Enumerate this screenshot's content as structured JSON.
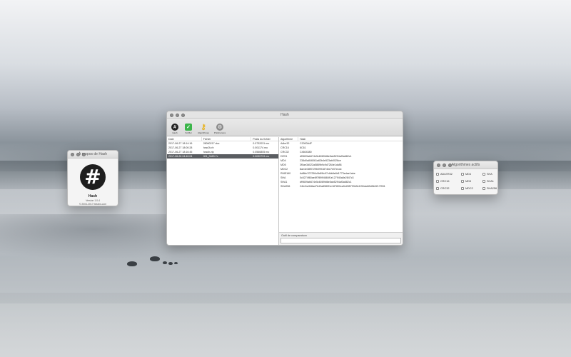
{
  "main_window": {
    "title": "Hash",
    "toolbar": [
      {
        "label": "Hash",
        "icon": "hash-icon"
      },
      {
        "label": "Vérifier",
        "icon": "shield-check-icon"
      },
      {
        "label": "Algorithmes",
        "icon": "key-icon"
      },
      {
        "label": "Préférences",
        "icon": "gear-icon"
      }
    ],
    "files_table": {
      "headers": [
        "Date",
        "Fichier",
        "Poids du fichier"
      ],
      "rows": [
        [
          "2017-06-27 18:14:16",
          "28060217.doc",
          "0.0732031 mo"
        ],
        [
          "2017-06-27 18:00:28",
          "hxsr2k.rb",
          "0.001174 mo"
        ],
        [
          "2017-06-27 18:16:45",
          "hxsdir.zip",
          "0.0566805 mo"
        ],
        [
          "2017-06-26 04:40:04",
          "001_0483.7c",
          "0.0035793 mo"
        ]
      ],
      "selected_index": 3
    },
    "hash_table": {
      "headers": [
        "Algorithme",
        "Hash"
      ],
      "rows": [
        [
          "Adler32",
          "C2000A4F"
        ],
        [
          "CRC16",
          "6C61"
        ],
        [
          "CRC32",
          "C4604380"
        ],
        [
          "DES1",
          "df9609ab674e5c6069fd6e5ab5294af3a682c1"
        ],
        [
          "MD4",
          "238d0a846061a63b4e523ab0026ce"
        ],
        [
          "MD5",
          "3f0ae3d022a5869b9c9d7264e1dc88"
        ],
        [
          "MDC2",
          "8ae4e38f0729b0991874be7e07ecdc"
        ],
        [
          "RMD160",
          "Ad8bb707250c0b89fc97cfdb8e8d1773edae1abe"
        ],
        [
          "SHA",
          "0c5274f60ae8f7f8994684f1e127940a8e2847c3"
        ],
        [
          "SHA1",
          "df9609ab674e5c6069fd6e5ab5294af3a682c1"
        ],
        [
          "SHA256",
          "24b41a348ad7b42a8980f1e187800ca9e285793b9e1f30dafd9d5b0217f931"
        ]
      ]
    },
    "compare": {
      "title": "Outil de comparaison",
      "value": ""
    }
  },
  "about_window": {
    "title": "À propos de Hash",
    "icon_glyph": "#",
    "app_name": "Hash",
    "version": "Version 1.0.4",
    "copyright": "© 2004-2017 fdeahs.com"
  },
  "algorithms_window": {
    "title": "Algorithmes actifs",
    "items": [
      "ADLER32",
      "MD4",
      "SHA",
      "CRC16",
      "MD5",
      "SHA1",
      "CRC32",
      "MDC2",
      "SHA256",
      "DES1",
      "RMD160"
    ]
  }
}
